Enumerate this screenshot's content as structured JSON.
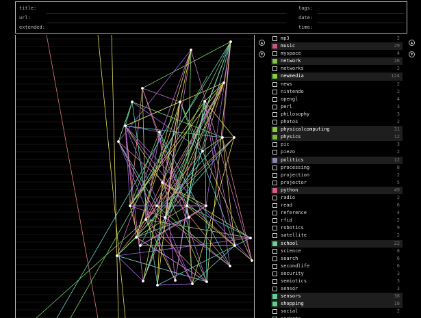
{
  "header": {
    "title_label": "title:",
    "url_label": "url:",
    "extended_label": "extended:",
    "tags_label": "tags:",
    "date_label": "date:",
    "time_label": "time:"
  },
  "scroll": {
    "up_icon": "chevron-up-icon",
    "down_icon": "chevron-down-icon"
  },
  "tags": [
    {
      "name": "mp3",
      "count": "2",
      "color": ""
    },
    {
      "name": "music",
      "count": "29",
      "color": "#c2587a"
    },
    {
      "name": "myspace",
      "count": "4",
      "color": ""
    },
    {
      "name": "network",
      "count": "26",
      "color": "#7dc447"
    },
    {
      "name": "networks",
      "count": "2",
      "color": ""
    },
    {
      "name": "newmedia",
      "count": "124",
      "color": "#88cc44"
    },
    {
      "name": "news",
      "count": "2",
      "color": ""
    },
    {
      "name": "nintendo",
      "count": "2",
      "color": ""
    },
    {
      "name": "opengl",
      "count": "4",
      "color": ""
    },
    {
      "name": "perl",
      "count": "3",
      "color": ""
    },
    {
      "name": "philosophy",
      "count": "3",
      "color": ""
    },
    {
      "name": "photos",
      "count": "2",
      "color": ""
    },
    {
      "name": "physicalcomputing",
      "count": "31",
      "color": "#8acb3e"
    },
    {
      "name": "physics",
      "count": "12",
      "color": "#7ab836"
    },
    {
      "name": "pic",
      "count": "3",
      "color": ""
    },
    {
      "name": "piezo",
      "count": "2",
      "color": ""
    },
    {
      "name": "politics",
      "count": "12",
      "color": "#8a88ba"
    },
    {
      "name": "processing",
      "count": "8",
      "color": ""
    },
    {
      "name": "projection",
      "count": "2",
      "color": ""
    },
    {
      "name": "projector",
      "count": "5",
      "color": ""
    },
    {
      "name": "python",
      "count": "49",
      "color": "#d85a88"
    },
    {
      "name": "radio",
      "count": "2",
      "color": ""
    },
    {
      "name": "read",
      "count": "6",
      "color": ""
    },
    {
      "name": "reference",
      "count": "4",
      "color": ""
    },
    {
      "name": "rfid",
      "count": "2",
      "color": ""
    },
    {
      "name": "robotics",
      "count": "9",
      "color": ""
    },
    {
      "name": "satellite",
      "count": "2",
      "color": ""
    },
    {
      "name": "school",
      "count": "22",
      "color": "#6ecfa0"
    },
    {
      "name": "science",
      "count": "8",
      "color": ""
    },
    {
      "name": "search",
      "count": "6",
      "color": ""
    },
    {
      "name": "secondlife",
      "count": "6",
      "color": ""
    },
    {
      "name": "security",
      "count": "3",
      "color": ""
    },
    {
      "name": "semiotics",
      "count": "3",
      "color": ""
    },
    {
      "name": "sensor",
      "count": "3",
      "color": ""
    },
    {
      "name": "sensors",
      "count": "38",
      "color": "#5fce9a"
    },
    {
      "name": "shopping",
      "count": "18",
      "color": "#66cc88"
    },
    {
      "name": "social",
      "count": "2",
      "color": ""
    },
    {
      "name": "sockets",
      "count": "",
      "color": ""
    }
  ]
}
